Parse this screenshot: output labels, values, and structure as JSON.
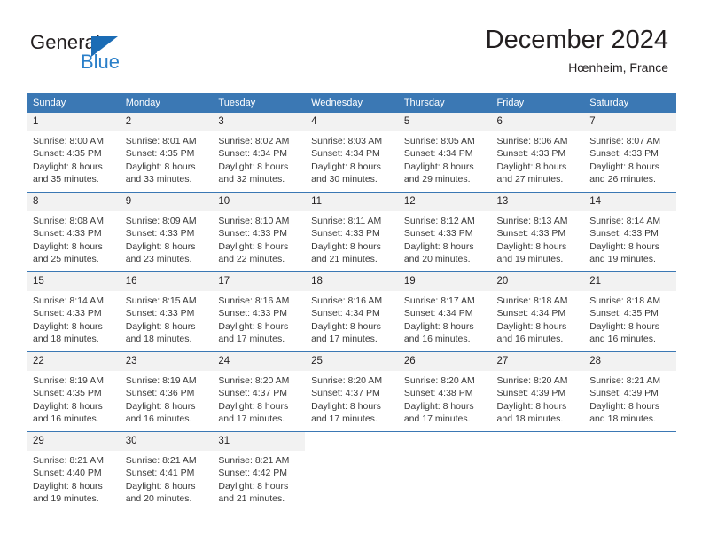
{
  "brand": {
    "name_part1": "General",
    "name_part2": "Blue",
    "triangle_color": "#1b6cb5",
    "blue_color": "#2a7fc9"
  },
  "header": {
    "title": "December 2024",
    "subtitle": "Hœnheim, France"
  },
  "theme": {
    "header_bg": "#3b78b4",
    "daynum_bg": "#f2f2f2",
    "grid_line": "#3b78b4",
    "text": "#231f20"
  },
  "weekday_headers": [
    "Sunday",
    "Monday",
    "Tuesday",
    "Wednesday",
    "Thursday",
    "Friday",
    "Saturday"
  ],
  "labels": {
    "sunrise_prefix": "Sunrise:",
    "sunset_prefix": "Sunset:",
    "daylight_prefix": "Daylight:"
  },
  "weeks": [
    [
      {
        "day": "1",
        "sunrise": "Sunrise: 8:00 AM",
        "sunset": "Sunset: 4:35 PM",
        "daylight1": "Daylight: 8 hours",
        "daylight2": "and 35 minutes."
      },
      {
        "day": "2",
        "sunrise": "Sunrise: 8:01 AM",
        "sunset": "Sunset: 4:35 PM",
        "daylight1": "Daylight: 8 hours",
        "daylight2": "and 33 minutes."
      },
      {
        "day": "3",
        "sunrise": "Sunrise: 8:02 AM",
        "sunset": "Sunset: 4:34 PM",
        "daylight1": "Daylight: 8 hours",
        "daylight2": "and 32 minutes."
      },
      {
        "day": "4",
        "sunrise": "Sunrise: 8:03 AM",
        "sunset": "Sunset: 4:34 PM",
        "daylight1": "Daylight: 8 hours",
        "daylight2": "and 30 minutes."
      },
      {
        "day": "5",
        "sunrise": "Sunrise: 8:05 AM",
        "sunset": "Sunset: 4:34 PM",
        "daylight1": "Daylight: 8 hours",
        "daylight2": "and 29 minutes."
      },
      {
        "day": "6",
        "sunrise": "Sunrise: 8:06 AM",
        "sunset": "Sunset: 4:33 PM",
        "daylight1": "Daylight: 8 hours",
        "daylight2": "and 27 minutes."
      },
      {
        "day": "7",
        "sunrise": "Sunrise: 8:07 AM",
        "sunset": "Sunset: 4:33 PM",
        "daylight1": "Daylight: 8 hours",
        "daylight2": "and 26 minutes."
      }
    ],
    [
      {
        "day": "8",
        "sunrise": "Sunrise: 8:08 AM",
        "sunset": "Sunset: 4:33 PM",
        "daylight1": "Daylight: 8 hours",
        "daylight2": "and 25 minutes."
      },
      {
        "day": "9",
        "sunrise": "Sunrise: 8:09 AM",
        "sunset": "Sunset: 4:33 PM",
        "daylight1": "Daylight: 8 hours",
        "daylight2": "and 23 minutes."
      },
      {
        "day": "10",
        "sunrise": "Sunrise: 8:10 AM",
        "sunset": "Sunset: 4:33 PM",
        "daylight1": "Daylight: 8 hours",
        "daylight2": "and 22 minutes."
      },
      {
        "day": "11",
        "sunrise": "Sunrise: 8:11 AM",
        "sunset": "Sunset: 4:33 PM",
        "daylight1": "Daylight: 8 hours",
        "daylight2": "and 21 minutes."
      },
      {
        "day": "12",
        "sunrise": "Sunrise: 8:12 AM",
        "sunset": "Sunset: 4:33 PM",
        "daylight1": "Daylight: 8 hours",
        "daylight2": "and 20 minutes."
      },
      {
        "day": "13",
        "sunrise": "Sunrise: 8:13 AM",
        "sunset": "Sunset: 4:33 PM",
        "daylight1": "Daylight: 8 hours",
        "daylight2": "and 19 minutes."
      },
      {
        "day": "14",
        "sunrise": "Sunrise: 8:14 AM",
        "sunset": "Sunset: 4:33 PM",
        "daylight1": "Daylight: 8 hours",
        "daylight2": "and 19 minutes."
      }
    ],
    [
      {
        "day": "15",
        "sunrise": "Sunrise: 8:14 AM",
        "sunset": "Sunset: 4:33 PM",
        "daylight1": "Daylight: 8 hours",
        "daylight2": "and 18 minutes."
      },
      {
        "day": "16",
        "sunrise": "Sunrise: 8:15 AM",
        "sunset": "Sunset: 4:33 PM",
        "daylight1": "Daylight: 8 hours",
        "daylight2": "and 18 minutes."
      },
      {
        "day": "17",
        "sunrise": "Sunrise: 8:16 AM",
        "sunset": "Sunset: 4:33 PM",
        "daylight1": "Daylight: 8 hours",
        "daylight2": "and 17 minutes."
      },
      {
        "day": "18",
        "sunrise": "Sunrise: 8:16 AM",
        "sunset": "Sunset: 4:34 PM",
        "daylight1": "Daylight: 8 hours",
        "daylight2": "and 17 minutes."
      },
      {
        "day": "19",
        "sunrise": "Sunrise: 8:17 AM",
        "sunset": "Sunset: 4:34 PM",
        "daylight1": "Daylight: 8 hours",
        "daylight2": "and 16 minutes."
      },
      {
        "day": "20",
        "sunrise": "Sunrise: 8:18 AM",
        "sunset": "Sunset: 4:34 PM",
        "daylight1": "Daylight: 8 hours",
        "daylight2": "and 16 minutes."
      },
      {
        "day": "21",
        "sunrise": "Sunrise: 8:18 AM",
        "sunset": "Sunset: 4:35 PM",
        "daylight1": "Daylight: 8 hours",
        "daylight2": "and 16 minutes."
      }
    ],
    [
      {
        "day": "22",
        "sunrise": "Sunrise: 8:19 AM",
        "sunset": "Sunset: 4:35 PM",
        "daylight1": "Daylight: 8 hours",
        "daylight2": "and 16 minutes."
      },
      {
        "day": "23",
        "sunrise": "Sunrise: 8:19 AM",
        "sunset": "Sunset: 4:36 PM",
        "daylight1": "Daylight: 8 hours",
        "daylight2": "and 16 minutes."
      },
      {
        "day": "24",
        "sunrise": "Sunrise: 8:20 AM",
        "sunset": "Sunset: 4:37 PM",
        "daylight1": "Daylight: 8 hours",
        "daylight2": "and 17 minutes."
      },
      {
        "day": "25",
        "sunrise": "Sunrise: 8:20 AM",
        "sunset": "Sunset: 4:37 PM",
        "daylight1": "Daylight: 8 hours",
        "daylight2": "and 17 minutes."
      },
      {
        "day": "26",
        "sunrise": "Sunrise: 8:20 AM",
        "sunset": "Sunset: 4:38 PM",
        "daylight1": "Daylight: 8 hours",
        "daylight2": "and 17 minutes."
      },
      {
        "day": "27",
        "sunrise": "Sunrise: 8:20 AM",
        "sunset": "Sunset: 4:39 PM",
        "daylight1": "Daylight: 8 hours",
        "daylight2": "and 18 minutes."
      },
      {
        "day": "28",
        "sunrise": "Sunrise: 8:21 AM",
        "sunset": "Sunset: 4:39 PM",
        "daylight1": "Daylight: 8 hours",
        "daylight2": "and 18 minutes."
      }
    ],
    [
      {
        "day": "29",
        "sunrise": "Sunrise: 8:21 AM",
        "sunset": "Sunset: 4:40 PM",
        "daylight1": "Daylight: 8 hours",
        "daylight2": "and 19 minutes."
      },
      {
        "day": "30",
        "sunrise": "Sunrise: 8:21 AM",
        "sunset": "Sunset: 4:41 PM",
        "daylight1": "Daylight: 8 hours",
        "daylight2": "and 20 minutes."
      },
      {
        "day": "31",
        "sunrise": "Sunrise: 8:21 AM",
        "sunset": "Sunset: 4:42 PM",
        "daylight1": "Daylight: 8 hours",
        "daylight2": "and 21 minutes."
      },
      {
        "day": "",
        "sunrise": "",
        "sunset": "",
        "daylight1": "",
        "daylight2": ""
      },
      {
        "day": "",
        "sunrise": "",
        "sunset": "",
        "daylight1": "",
        "daylight2": ""
      },
      {
        "day": "",
        "sunrise": "",
        "sunset": "",
        "daylight1": "",
        "daylight2": ""
      },
      {
        "day": "",
        "sunrise": "",
        "sunset": "",
        "daylight1": "",
        "daylight2": ""
      }
    ]
  ]
}
